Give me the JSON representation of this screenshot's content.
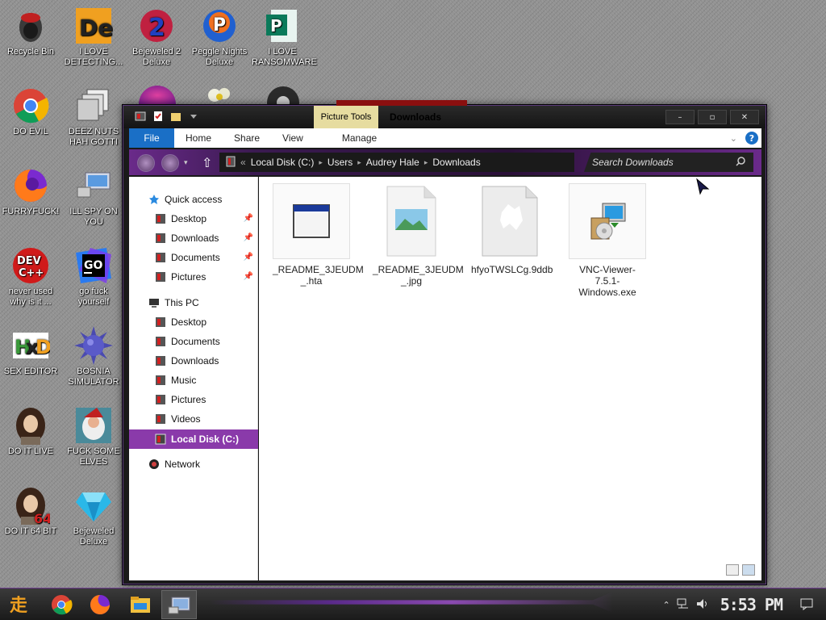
{
  "desktop": {
    "icons": [
      {
        "label": "Recycle Bin",
        "icon": "recycle-bin-icon"
      },
      {
        "label": "I LOVE\nDETECTING...",
        "icon": "de-app-icon"
      },
      {
        "label": "Bejeweled 2\nDeluxe",
        "icon": "bejeweled-2-icon"
      },
      {
        "label": "Peggle Nights\nDeluxe",
        "icon": "peggle-icon"
      },
      {
        "label": "I LOVE\nRANSOMWARE",
        "icon": "publisher-icon"
      },
      {
        "label": "DO EVIL",
        "icon": "chrome-icon"
      },
      {
        "label": "DEEZ NUTS\nHAH GOTTI",
        "icon": "stacked-windows-icon"
      },
      {
        "label": "FURRYFUCK!",
        "icon": "firefox-icon"
      },
      {
        "label": "ILL SPY ON\nYOU",
        "icon": "remote-desktop-icon"
      },
      {
        "label": "never used\nwhy is it ...",
        "icon": "devcpp-icon"
      },
      {
        "label": "go fuck\nyourself",
        "icon": "goland-icon"
      },
      {
        "label": "SEX EDITOR",
        "icon": "hxd-icon"
      },
      {
        "label": "BOSNIA\nSIMULATOR",
        "icon": "spiked-ball-icon"
      },
      {
        "label": "DO IT LIVE",
        "icon": "portrait-icon"
      },
      {
        "label": "FUCK SOME\nELVES",
        "icon": "santa-icon"
      },
      {
        "label": "DO IT 64 BIT",
        "icon": "portrait-64-icon"
      },
      {
        "label": "Bejeweled\nDeluxe",
        "icon": "diamond-icon"
      }
    ]
  },
  "window": {
    "title": "Downloads",
    "contextual_tab": "Picture Tools",
    "controls": {
      "minimize": "–",
      "maximize": "▫",
      "close": "✕"
    },
    "ribbon_tabs": [
      "File",
      "Home",
      "Share",
      "View",
      "Manage"
    ],
    "help": "?",
    "breadcrumb": [
      "Local Disk (C:)",
      "Users",
      "Audrey Hale",
      "Downloads"
    ],
    "breadcrumb_prefix": "«",
    "search_placeholder": "Search Downloads",
    "nav": {
      "quick_access": "Quick access",
      "quick_items": [
        "Desktop",
        "Downloads",
        "Documents",
        "Pictures"
      ],
      "this_pc": "This PC",
      "pc_items": [
        "Desktop",
        "Documents",
        "Downloads",
        "Music",
        "Pictures",
        "Videos"
      ],
      "local_disk": "Local Disk (C:)",
      "network": "Network"
    },
    "files": [
      {
        "name": "_README_3JEUDM\n_.hta",
        "icon": "hta-window-icon"
      },
      {
        "name": "_README_3JEUDM\n_.jpg",
        "icon": "image-file-icon"
      },
      {
        "name": "hfyoTWSLCg.9ddb",
        "icon": "blank-file-icon"
      },
      {
        "name": "VNC-Viewer-7.5.1-\nWindows.exe",
        "icon": "installer-icon"
      }
    ]
  },
  "taskbar": {
    "clock": "5:53 PM",
    "apps": [
      "start-icon",
      "chrome-icon",
      "firefox-icon",
      "file-explorer-icon",
      "remote-desktop-icon"
    ]
  },
  "colors": {
    "accent_purple": "#8a3aaa",
    "file_tab_blue": "#1a6fc6",
    "picture_tools": "#e6dca0"
  }
}
